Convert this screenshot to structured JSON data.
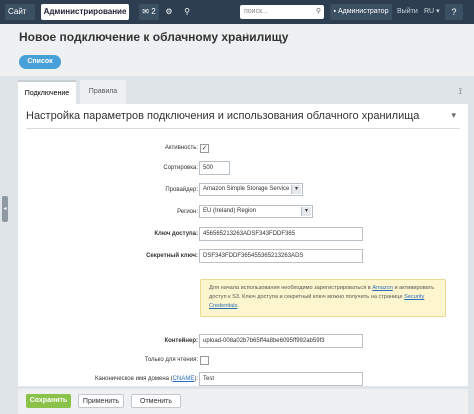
{
  "topbar": {
    "site": "Сайт",
    "admin": "Администрирование",
    "notifications_count": "2",
    "search_placeholder": "поиск...",
    "user": "Администратор",
    "exit": "Выйти",
    "lang": "RU",
    "help": "?"
  },
  "page": {
    "title": "Новое подключение к облачному хранилищу",
    "list_button": "Список"
  },
  "tabs": [
    {
      "label": "Подключение"
    },
    {
      "label": "Правила"
    }
  ],
  "section": {
    "title": "Настройка параметров подключения и использования облачного хранилища"
  },
  "form": {
    "active_label": "Активность:",
    "active_checked": "✓",
    "sort_label": "Сортировка:",
    "sort_value": "500",
    "provider_label": "Провайдер:",
    "provider_value": "Amazon Simple Storage Service",
    "region_label": "Регион:",
    "region_value": "EU (Ireland) Region",
    "access_key_label": "Ключ доступа:",
    "access_key_value": "456565213263ADSF343FDDF365",
    "secret_key_label": "Секретный ключ:",
    "secret_key_value": "DSF343FDDF365455365213263ADS",
    "note_part1": "Для начала использования необходимо зарегистрироваться в",
    "note_link1": "Amazon",
    "note_part2": "и активировать доступ к S3. Ключ доступа и секретный ключ можно получить на странице",
    "note_link2": "Security Credentials",
    "container_label": "Контейнер:",
    "container_value": "upload-008a02b7b65ff4a8be6095ff992ab59f3",
    "readonly_label": "Только для чтения:",
    "cname_label_part1": "Каноническое имя домена (",
    "cname_link": "CNAME",
    "cname_label_part2": "):",
    "cname_value": "Test"
  },
  "buttons": {
    "save": "Сохранить",
    "apply": "Применить",
    "cancel": "Отменить"
  },
  "colors": {
    "topbar": "#2c3e50",
    "accent_blue": "#47a0d8",
    "save_green": "#8bc24a",
    "note_bg": "#fdf5ce"
  }
}
